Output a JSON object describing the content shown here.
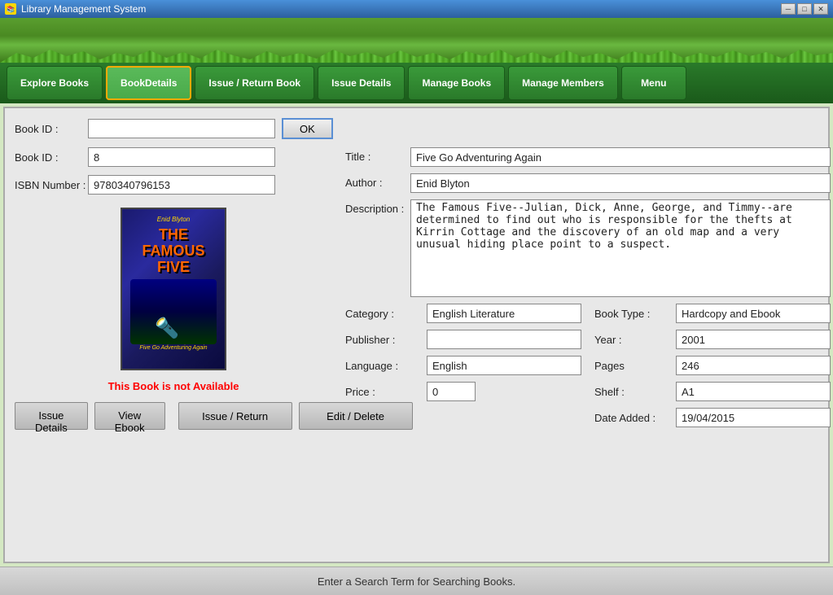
{
  "titlebar": {
    "title": "Library Management System",
    "icon": "📚",
    "minimize": "─",
    "maximize": "□",
    "close": "✕"
  },
  "nav": {
    "items": [
      {
        "id": "explore-books",
        "label": "Explore Books",
        "active": false
      },
      {
        "id": "book-details",
        "label": "BookDetails",
        "active": true
      },
      {
        "id": "issue-return",
        "label": "Issue / Return Book",
        "active": false
      },
      {
        "id": "issue-details",
        "label": "Issue Details",
        "active": false
      },
      {
        "id": "manage-books",
        "label": "Manage Books",
        "active": false
      },
      {
        "id": "manage-members",
        "label": "Manage Members",
        "active": false
      },
      {
        "id": "menu",
        "label": "Menu",
        "active": false
      }
    ]
  },
  "form": {
    "book_id_label": "Book ID :",
    "book_id_value": "",
    "ok_label": "OK",
    "book_id2_label": "Book ID :",
    "book_id2_value": "8",
    "isbn_label": "ISBN Number :",
    "isbn_value": "9780340796153"
  },
  "book": {
    "title_label": "Title :",
    "title_value": "Five Go Adventuring Again",
    "author_label": "Author :",
    "author_value": "Enid Blyton",
    "description_label": "Description :",
    "description_value": "The Famous Five--Julian, Dick, Anne, George, and Timmy--are determined to find out who is responsible for the thefts at Kirrin Cottage and the discovery of an old map and a very unusual hiding place point to a suspect.",
    "category_label": "Category :",
    "category_value": "English Literature",
    "book_type_label": "Book Type :",
    "book_type_value": "Hardcopy and Ebook",
    "publisher_label": "Publisher :",
    "publisher_value": "",
    "year_label": "Year :",
    "year_value": "2001",
    "language_label": "Language :",
    "language_value": "English",
    "pages_label": "Pages",
    "pages_value": "246",
    "price_label": "Price :",
    "price_value": "0",
    "shelf_label": "Shelf :",
    "shelf_value": "A1",
    "date_added_label": "Date Added :",
    "date_added_value": "19/04/2015",
    "availability": "This Book is not Available"
  },
  "buttons": {
    "issue_details": "Issue Details",
    "view_ebook": "View Ebook",
    "issue_return": "Issue / Return",
    "edit_delete": "Edit / Delete"
  },
  "status_bar": {
    "message": "Enter a Search Term for Searching Books."
  },
  "cover": {
    "author_line": "Enid Blyton",
    "series": "THE FAMOUS",
    "title": "FIVE",
    "subtitle": "Five Go Adventuring Again"
  }
}
